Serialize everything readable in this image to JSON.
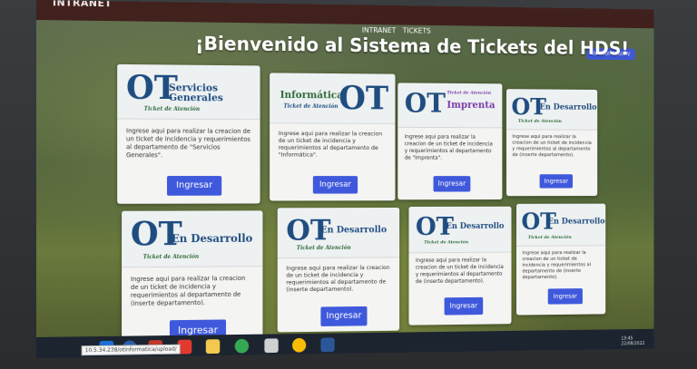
{
  "app": {
    "brand": "INTRANET"
  },
  "nav": {
    "items": [
      "INTRANET",
      "TICKETS"
    ]
  },
  "header": {
    "title": "¡Bienvenido al Sistema de Tickets del HDS!",
    "signin_label": "INICIAR SESION"
  },
  "cards": [
    {
      "logo_text": "Servicios Generales",
      "desc": "Ingrese aqui para realizar la creacion de un ticket de incidencia y requerimientos al departamento de \"Servicios Generales\".",
      "button": "Ingresar"
    },
    {
      "logo_text": "Informática",
      "desc": "Ingrese aqui para realizar la creacion de un ticket de incidencia y requerimientos al departamento de \"Informática\".",
      "button": "Ingresar"
    },
    {
      "logo_text": "Imprenta",
      "desc": "Ingrese aqui para realizar la creacion de un ticket de incidencia y requerimientos al departamento de \"Imprenta\".",
      "button": "Ingresar"
    },
    {
      "logo_text": "En Desarrollo",
      "desc": "Ingrese aqui para realizar la creacion de un ticket de incidencia y requerimientos al departamento de (inserte departamento).",
      "button": "Ingresar"
    },
    {
      "logo_text": "En Desarrollo",
      "desc": "Ingrese aqui para realizar la creacion de un ticket de incidencia y requerimientos al departamento de (inserte departamento).",
      "button": "Ingresar"
    },
    {
      "logo_text": "En Desarrollo",
      "desc": "Ingrese aqui para realizar la creacion de un ticket de incidencia y requerimientos al departamento de (inserte departamento).",
      "button": "Ingresar"
    },
    {
      "logo_text": "En Desarrollo",
      "desc": "Ingrese aqui para realizar la creacion de un ticket de incidencia y requerimientos al departamento de (inserte departamento).",
      "button": "Ingresar"
    },
    {
      "logo_text": "En Desarrollo",
      "desc": "Ingrese aqui para realizar la creacion de un ticket de incidencia y requerimientos al departamento de (inserte departamento).",
      "button": "Ingresar"
    }
  ],
  "logo": {
    "ot": "OT",
    "ticket_label": "Ticket de Atención",
    "imprenta_top": "Ticket de Atención"
  },
  "status_url": "10.5.34.238/otinformatica/upload/",
  "taskbar": {
    "icons": [
      "windows-icon",
      "search-icon",
      "task-view-icon",
      "edge-icon",
      "pdf-icon",
      "folder-icon",
      "chrome-icon",
      "outlook-icon",
      "chrome-icon",
      "word-icon"
    ]
  },
  "tray": {
    "time": "13:45",
    "date": "22/08/2022"
  },
  "colors": {
    "button": "#3f59dc",
    "ot_blue": "#1f4d80",
    "ticket_green": "#2d6a3a"
  }
}
